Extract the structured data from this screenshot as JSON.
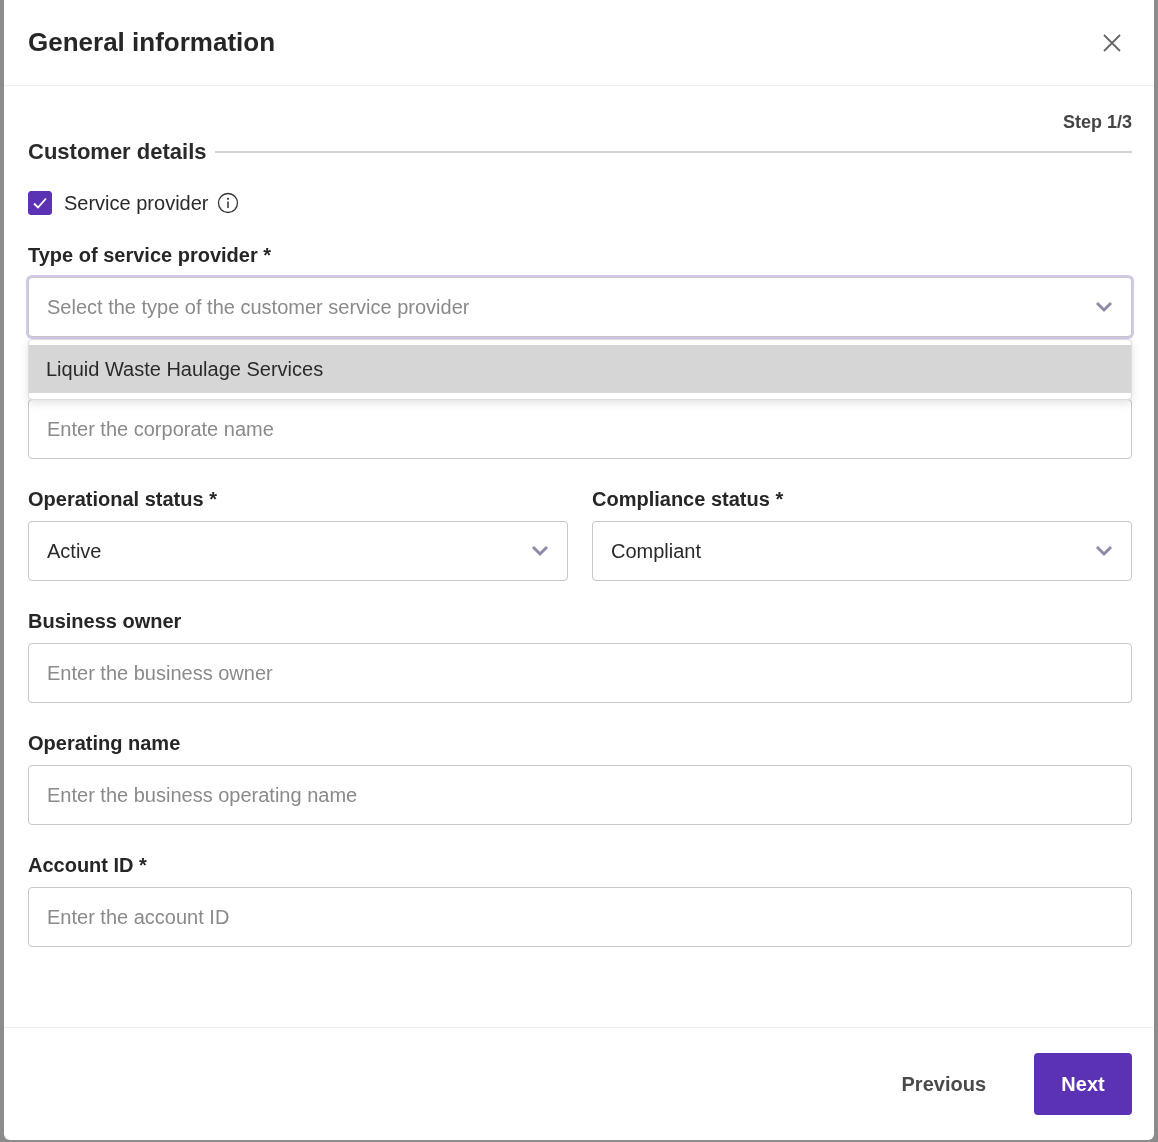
{
  "dialog": {
    "title": "General information",
    "step": "Step 1/3",
    "section_title": "Customer details"
  },
  "service_provider": {
    "label": "Service provider",
    "checked": true
  },
  "provider_type": {
    "label": "Type of service provider *",
    "placeholder": "Select the type of the customer service provider",
    "expanded": true,
    "options": [
      {
        "label": "Liquid Waste Haulage Services",
        "highlighted": true
      }
    ]
  },
  "rows": [
    [
      {
        "kind": "text",
        "placeholder": "Enter the corporate name"
      }
    ],
    [
      {
        "kind": "select",
        "label": "Operational status *",
        "value": "Active"
      },
      {
        "kind": "select",
        "label": "Compliance status *",
        "value": "Compliant"
      }
    ],
    [
      {
        "kind": "text",
        "label": "Business owner",
        "placeholder": "Enter the business owner"
      }
    ],
    [
      {
        "kind": "text",
        "label": "Operating name",
        "placeholder": "Enter the business operating name"
      }
    ],
    [
      {
        "kind": "text",
        "label": "Account ID *",
        "placeholder": "Enter the account ID"
      }
    ]
  ],
  "buttons": {
    "previous": "Previous",
    "next": "Next"
  }
}
